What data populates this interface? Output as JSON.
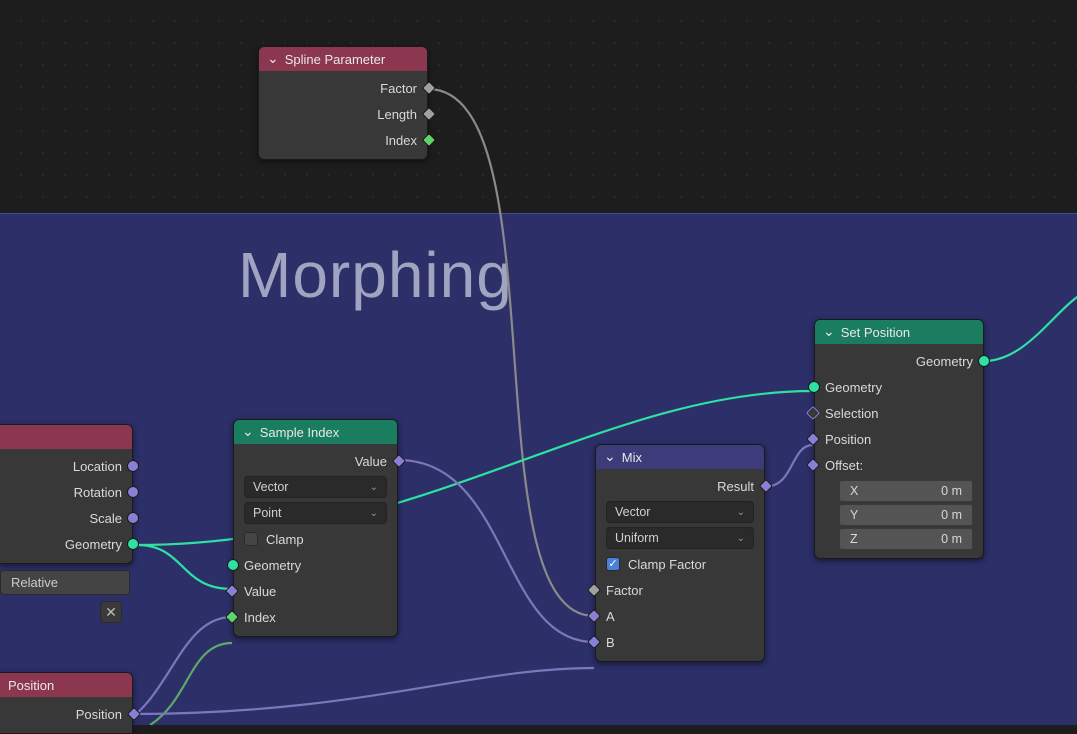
{
  "frame": {
    "title": "Morphing"
  },
  "nodes": {
    "spline_param": {
      "title": "Spline Parameter",
      "outputs": {
        "factor": "Factor",
        "length": "Length",
        "index": "Index"
      }
    },
    "sample_index": {
      "title": "Sample Index",
      "outputs": {
        "value": "Value"
      },
      "select_type": "Vector",
      "select_domain": "Point",
      "clamp_label": "Clamp",
      "clamp_checked": false,
      "inputs": {
        "geometry": "Geometry",
        "value": "Value",
        "index": "Index"
      }
    },
    "mix": {
      "title": "Mix",
      "outputs": {
        "result": "Result"
      },
      "select_type": "Vector",
      "select_mode": "Uniform",
      "clamp_factor_label": "Clamp Factor",
      "clamp_factor_checked": true,
      "inputs": {
        "factor": "Factor",
        "a": "A",
        "b": "B"
      }
    },
    "set_position": {
      "title": "Set Position",
      "outputs": {
        "geometry": "Geometry"
      },
      "inputs": {
        "geometry": "Geometry",
        "selection": "Selection",
        "position": "Position",
        "offset_label": "Offset:",
        "offset": {
          "x_label": "X",
          "x": "0 m",
          "y_label": "Y",
          "y": "0 m",
          "z_label": "Z",
          "z": "0 m"
        }
      }
    },
    "instance_node": {
      "outputs": {
        "location": "Location",
        "rotation": "Rotation",
        "scale": "Scale",
        "geometry": "Geometry"
      },
      "relative_label": "Relative"
    },
    "position_node": {
      "title": "Position",
      "outputs": {
        "position": "Position"
      }
    }
  }
}
